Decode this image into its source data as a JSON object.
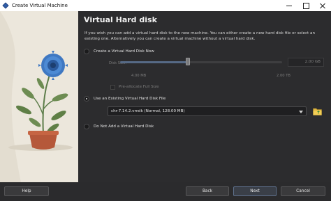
{
  "window": {
    "title": "Create Virtual Machine"
  },
  "page": {
    "title": "Virtual Hard disk",
    "description": "If you wish you can add a virtual hard disk to the new machine. You can either create a new hard disk file or select an existing one. Alternatively you can create a virtual machine without a virtual hard disk."
  },
  "options": {
    "create_new": "Create a Virtual Hard Disk Now",
    "use_existing": "Use an Existing Virtual Hard Disk File",
    "no_disk": "Do Not Add a Virtual Hard Disk",
    "selected": "use_existing"
  },
  "disk": {
    "size_label": "Disk Size:",
    "size_value": "2.00 GB",
    "min_label": "4.00 MB",
    "max_label": "2.00 TB",
    "slider_fraction": 0.42,
    "preallocate_label": "Pre-allocate Full Size"
  },
  "existing": {
    "selected_file": "chr-7.14.2.vmdk (Normal, 128.00 MB)"
  },
  "buttons": {
    "help": "Help",
    "back": "Back",
    "next": "Next",
    "cancel": "Cancel"
  }
}
